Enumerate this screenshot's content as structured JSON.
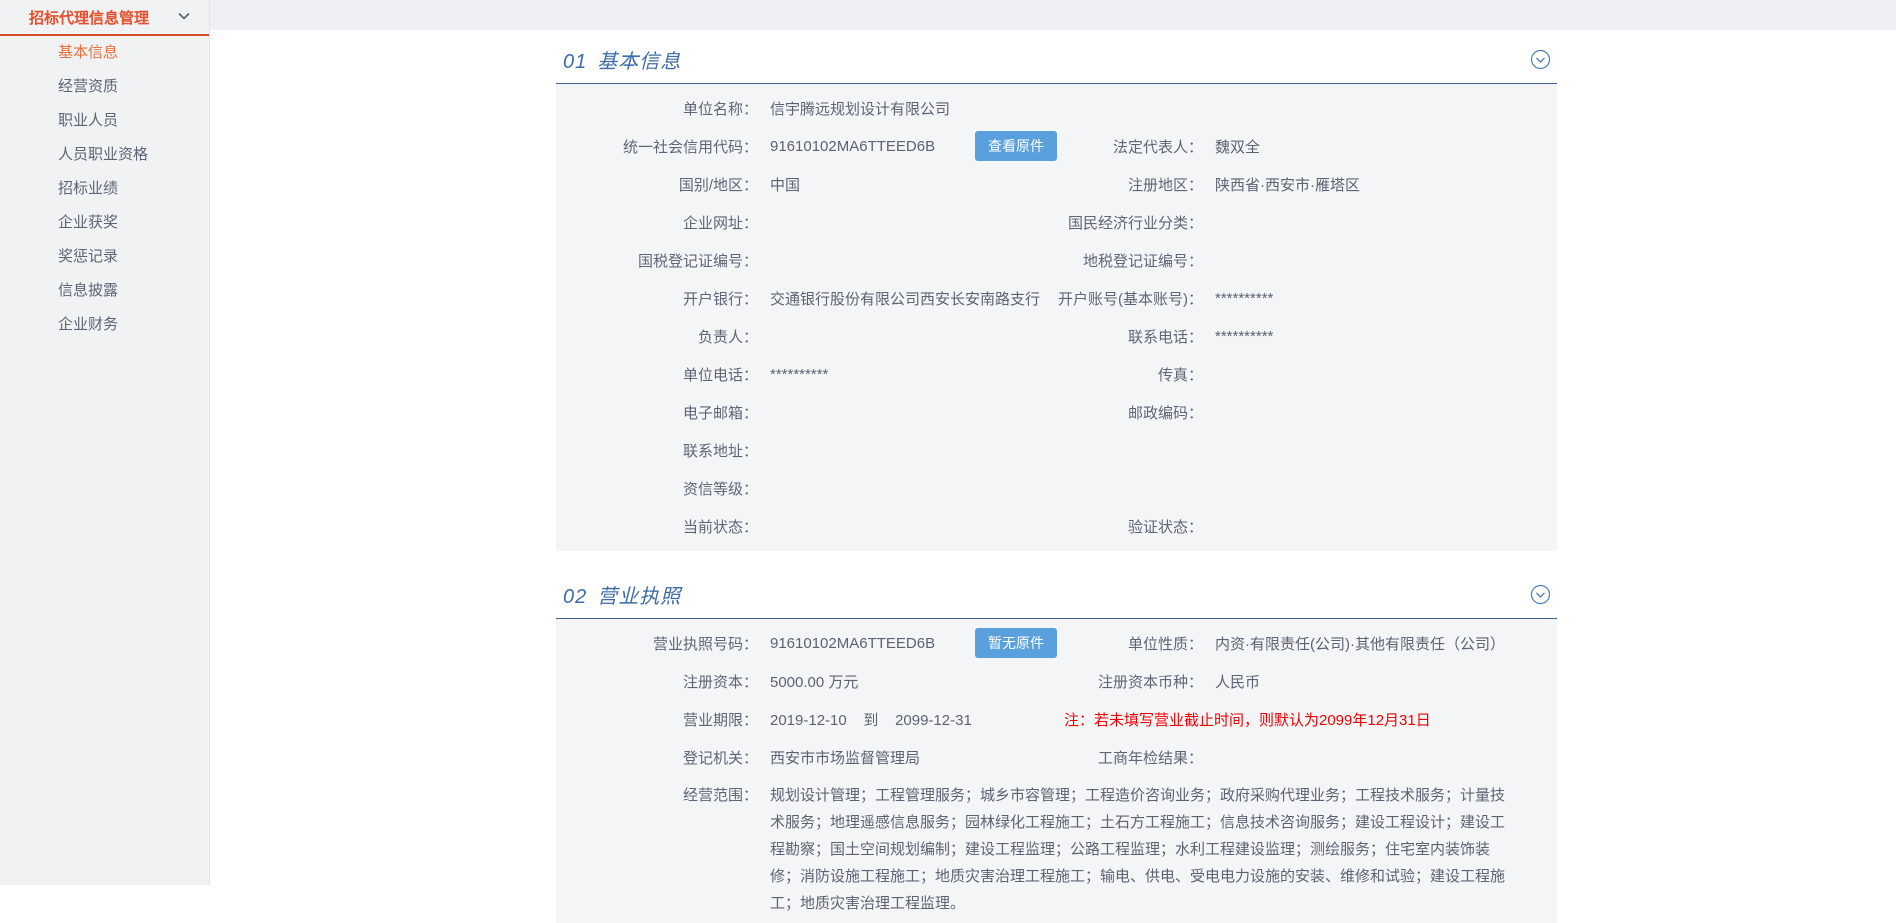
{
  "colors": {
    "accent_orange": "#e64f2b",
    "active_item_orange": "#e8723f",
    "section_blue": "#3e6ca8",
    "button_blue": "#59a0dd",
    "note_red": "#f20000",
    "panel_grey": "#f4f5f7"
  },
  "sidebar": {
    "title": "招标代理信息管理",
    "chevron_icon": "chevron-down",
    "items": [
      {
        "label": "基本信息",
        "active": true
      },
      {
        "label": "经营资质",
        "active": false
      },
      {
        "label": "职业人员",
        "active": false
      },
      {
        "label": "人员职业资格",
        "active": false
      },
      {
        "label": "招标业绩",
        "active": false
      },
      {
        "label": "企业获奖",
        "active": false
      },
      {
        "label": "奖惩记录",
        "active": false
      },
      {
        "label": "信息披露",
        "active": false
      },
      {
        "label": "企业财务",
        "active": false
      }
    ]
  },
  "sections": [
    {
      "number": "01",
      "title": "基本信息",
      "rows": [
        {
          "left": {
            "label": "单位名称：",
            "value": "信宇腾远规划设计有限公司"
          }
        },
        {
          "left": {
            "label": "统一社会信用代码：",
            "value": "91610102MA6TTEED6B",
            "button": "查看原件"
          },
          "right": {
            "label": "法定代表人：",
            "value": "魏双全"
          }
        },
        {
          "left": {
            "label": "国别/地区：",
            "value": "中国"
          },
          "right": {
            "label": "注册地区：",
            "value": "陕西省·西安市·雁塔区"
          }
        },
        {
          "left": {
            "label": "企业网址：",
            "value": ""
          },
          "right": {
            "label": "国民经济行业分类：",
            "value": ""
          }
        },
        {
          "left": {
            "label": "国税登记证编号：",
            "value": ""
          },
          "right": {
            "label": "地税登记证编号：",
            "value": ""
          }
        },
        {
          "left": {
            "label": "开户银行：",
            "value": "交通银行股份有限公司西安长安南路支行"
          },
          "right": {
            "label": "开户账号(基本账号)：",
            "value": "**********"
          }
        },
        {
          "left": {
            "label": "负责人：",
            "value": ""
          },
          "right": {
            "label": "联系电话：",
            "value": "**********"
          }
        },
        {
          "left": {
            "label": "单位电话：",
            "value": "**********"
          },
          "right": {
            "label": "传真：",
            "value": ""
          }
        },
        {
          "left": {
            "label": "电子邮箱：",
            "value": ""
          },
          "right": {
            "label": "邮政编码：",
            "value": ""
          }
        },
        {
          "left": {
            "label": "联系地址：",
            "value": ""
          }
        },
        {
          "left": {
            "label": "资信等级：",
            "value": ""
          }
        },
        {
          "left": {
            "label": "当前状态：",
            "value": ""
          },
          "right": {
            "label": "验证状态：",
            "value": ""
          }
        }
      ]
    },
    {
      "number": "02",
      "title": "营业执照",
      "rows": [
        {
          "left": {
            "label": "营业执照号码：",
            "value": "91610102MA6TTEED6B",
            "button": "暂无原件"
          },
          "right": {
            "label": "单位性质：",
            "value": "内资·有限责任(公司)·其他有限责任（公司）"
          }
        },
        {
          "left": {
            "label": "注册资本：",
            "value": "5000.00 万元"
          },
          "right": {
            "label": "注册资本币种：",
            "value": "人民币"
          }
        },
        {
          "left": {
            "label": "营业期限：",
            "value": "2019-12-10    到    2099-12-31"
          },
          "note": "注：若未填写营业截止时间，则默认为2099年12月31日"
        },
        {
          "left": {
            "label": "登记机关：",
            "value": "西安市市场监督管理局"
          },
          "right": {
            "label": "工商年检结果：",
            "value": ""
          }
        },
        {
          "wide": {
            "label": "经营范围：",
            "value": "规划设计管理；工程管理服务；城乡市容管理；工程造价咨询业务；政府采购代理业务；工程技术服务；计量技术服务；地理遥感信息服务；园林绿化工程施工；土石方工程施工；信息技术咨询服务；建设工程设计；建设工程勘察；国土空间规划编制；建设工程监理；公路工程监理；水利工程建设监理；测绘服务；住宅室内装饰装修；消防设施工程施工；地质灾害治理工程施工；输电、供电、受电电力设施的安装、维修和试验；建设工程施工；地质灾害治理工程监理。"
          }
        }
      ]
    }
  ]
}
